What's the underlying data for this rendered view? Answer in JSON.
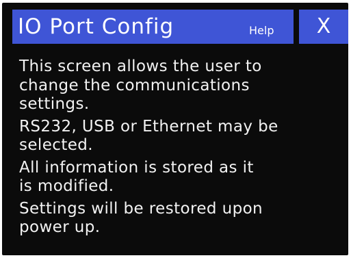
{
  "header": {
    "title": "IO Port Config",
    "help_label": "Help",
    "close_label": "X"
  },
  "help": {
    "paragraphs": [
      [
        "This screen allows the user to",
        "change the communications",
        "settings."
      ],
      [
        "RS232, USB or Ethernet may be",
        "selected."
      ],
      [
        "All information is stored as it",
        "is modified."
      ],
      [
        "Settings will be restored upon",
        "power up."
      ]
    ]
  },
  "colors": {
    "title_bar": "#3f55d6",
    "background": "#0b0b0b",
    "text": "#f2f2f2"
  }
}
